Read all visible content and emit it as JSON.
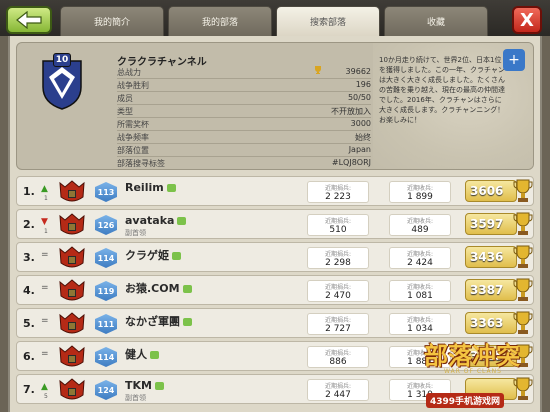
{
  "tabs": [
    {
      "label": "我的簡介",
      "active": false
    },
    {
      "label": "我的部落",
      "active": false
    },
    {
      "label": "搜索部落",
      "active": true
    },
    {
      "label": "收藏",
      "active": false
    }
  ],
  "close_label": "X",
  "clan": {
    "level": "10",
    "name": "クラクラチャンネル",
    "info": [
      {
        "label": "总战力",
        "value": "39662"
      },
      {
        "label": "战争胜利",
        "value": "196"
      },
      {
        "label": "成员",
        "value": "50/50"
      },
      {
        "label": "类型",
        "value": "不开放加入"
      },
      {
        "label": "所需奖杯",
        "value": "3000"
      },
      {
        "label": "战争频率",
        "value": "始终"
      },
      {
        "label": "部落位置",
        "value": "Japan"
      },
      {
        "label": "部落搜寻标签",
        "value": "#LQJ8ORJ"
      }
    ],
    "description": "10か月走り続けて、世界2位、日本1位を獲得しました。この一年、クラチャンは大きく大きく成長しました。たくさんの苦難を乗り越え、現在の最高の仲間達でした。2016年、クラチャンはさらに大きく成長します。クラチャンニング！お楽しみに！"
  },
  "donated_label": "近期捐兵:",
  "received_label": "近期收兵:",
  "members": [
    {
      "rank": "1.",
      "trend": "▲",
      "trend_sub": "1",
      "xp": "113",
      "name": "Reilim",
      "role": "",
      "donated": "2 223",
      "received": "1 899",
      "trophies": "3606"
    },
    {
      "rank": "2.",
      "trend": "▼",
      "trend_sub": "1",
      "xp": "126",
      "name": "avataka",
      "role": "副首领",
      "donated": "510",
      "received": "489",
      "trophies": "3597"
    },
    {
      "rank": "3.",
      "trend": "=",
      "trend_sub": "",
      "xp": "114",
      "name": "クラゲ姫",
      "role": "",
      "donated": "2 298",
      "received": "2 424",
      "trophies": "3436"
    },
    {
      "rank": "4.",
      "trend": "=",
      "trend_sub": "",
      "xp": "119",
      "name": "お猿.COM",
      "role": "",
      "donated": "2 470",
      "received": "1 081",
      "trophies": "3387"
    },
    {
      "rank": "5.",
      "trend": "=",
      "trend_sub": "",
      "xp": "111",
      "name": "なかざ軍團",
      "role": "",
      "donated": "2 727",
      "received": "1 034",
      "trophies": "3363"
    },
    {
      "rank": "6.",
      "trend": "=",
      "trend_sub": "",
      "xp": "114",
      "name": "健人",
      "role": "",
      "donated": "886",
      "received": "1 881",
      "trophies": "3315"
    },
    {
      "rank": "7.",
      "trend": "▲",
      "trend_sub": "5",
      "xp": "124",
      "name": "TKM",
      "role": "副首领",
      "donated": "2 447",
      "received": "1 310",
      "trophies": ""
    }
  ],
  "watermark": {
    "title": "部落冲突",
    "subtitle": "WAR OF CLANS",
    "site": "4399手机游戏网"
  }
}
